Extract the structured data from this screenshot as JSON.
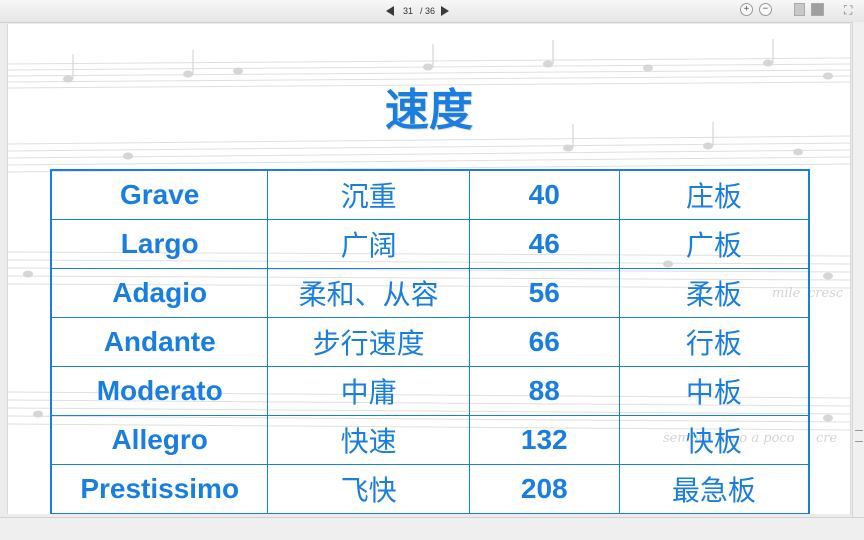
{
  "viewer": {
    "current_page": "31",
    "total_pages": "/ 36",
    "zoom_in_symbol": "+",
    "zoom_out_symbol": "−",
    "fit_symbol": "⛶"
  },
  "slide": {
    "title": "速度",
    "rows": [
      {
        "term": "Grave",
        "chinese": "沉重",
        "bpm": "40",
        "ban": "庄板"
      },
      {
        "term": "Largo",
        "chinese": "广阔",
        "bpm": "46",
        "ban": "广板"
      },
      {
        "term": "Adagio",
        "chinese": "柔和、从容",
        "bpm": "56",
        "ban": "柔板"
      },
      {
        "term": "Andante",
        "chinese": "步行速度",
        "bpm": "66",
        "ban": "行板"
      },
      {
        "term": "Moderato",
        "chinese": "中庸",
        "bpm": "88",
        "ban": "中板"
      },
      {
        "term": "Allegro",
        "chinese": "快速",
        "bpm": "132",
        "ban": "快板"
      },
      {
        "term": "Prestissimo",
        "chinese": "飞快",
        "bpm": "208",
        "ban": "最急板"
      }
    ],
    "background_words": [
      "mile",
      "cresc",
      "sempre",
      "poco a poco",
      "cre"
    ]
  },
  "colors": {
    "accent": "#1a7ee0",
    "slide_bg": "#ffffff",
    "toolbar_bg": "#ececec"
  }
}
